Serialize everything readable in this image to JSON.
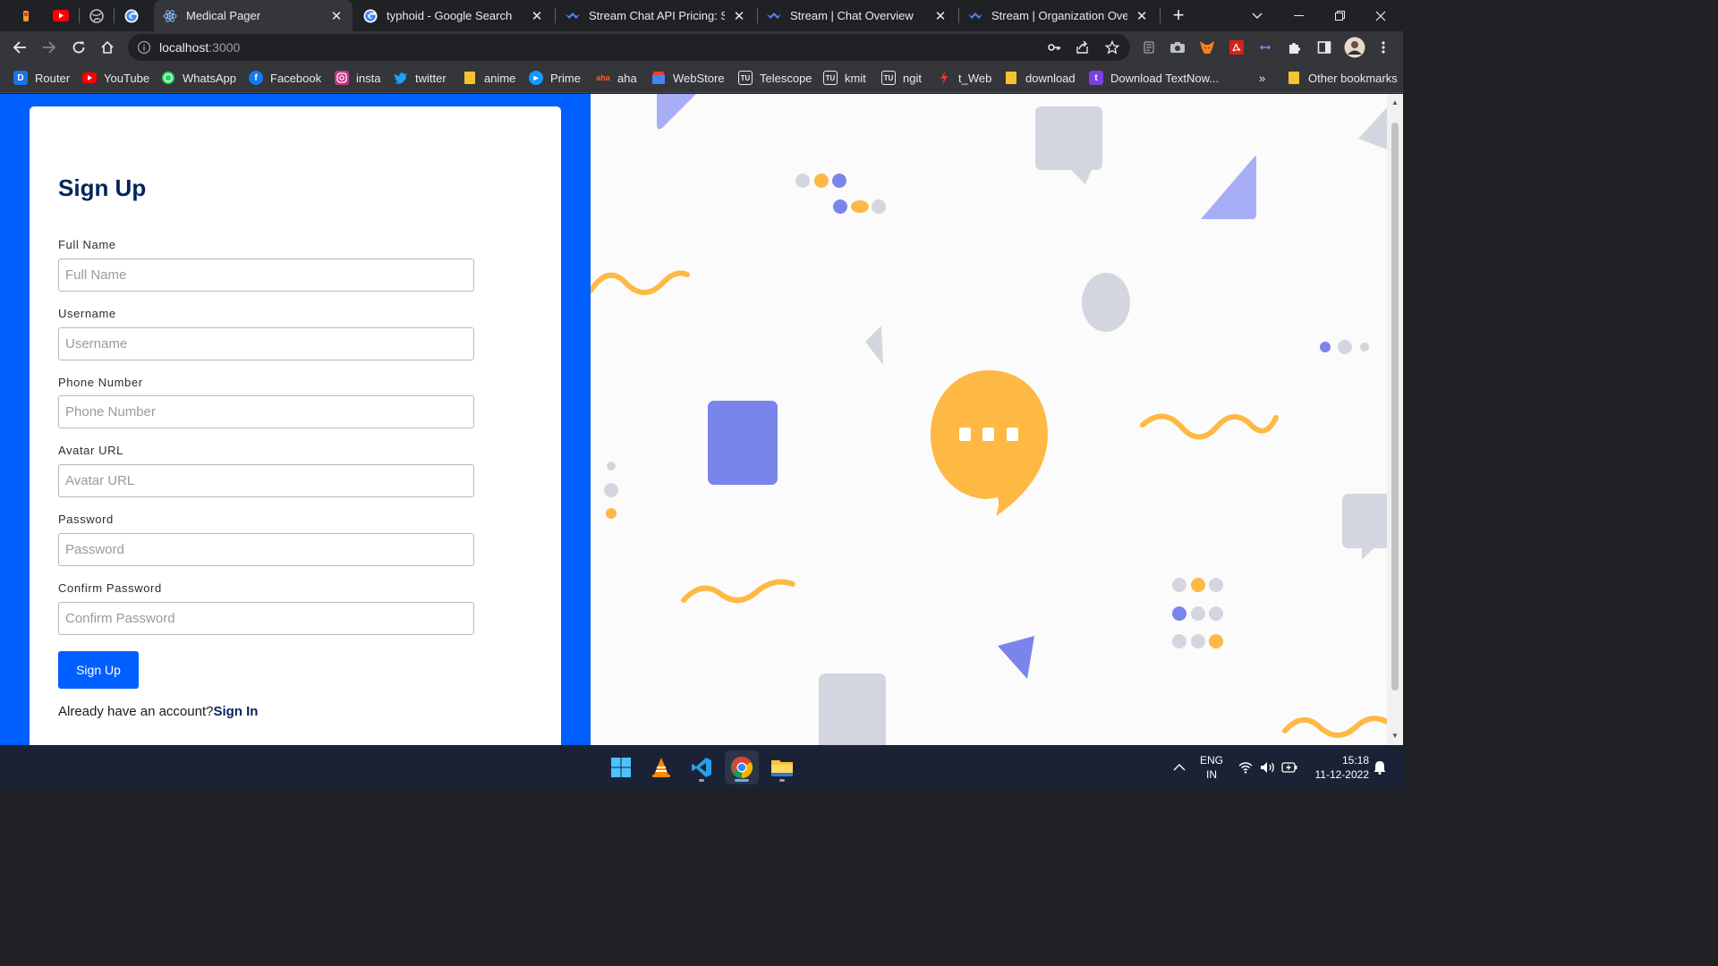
{
  "browser": {
    "tabs": [
      {
        "title": "Medical Pager",
        "icon": "react-icon",
        "active": true
      },
      {
        "title": "typhoid - Google Search",
        "icon": "google-icon",
        "active": false
      },
      {
        "title": "Stream Chat API Pricing: Start",
        "icon": "stream-icon",
        "active": false
      },
      {
        "title": "Stream | Chat Overview",
        "icon": "stream-icon",
        "active": false
      },
      {
        "title": "Stream | Organization Overvie",
        "icon": "stream-icon",
        "active": false
      }
    ],
    "url_host": "localhost",
    "url_port": ":3000",
    "bookmarks": [
      {
        "label": "Router",
        "icon": "d-icon",
        "color": "#1a73e8"
      },
      {
        "label": "YouTube",
        "icon": "youtube-icon",
        "color": "#ff0000"
      },
      {
        "label": "WhatsApp",
        "icon": "whatsapp-icon",
        "color": "#25d366"
      },
      {
        "label": "Facebook",
        "icon": "facebook-icon",
        "color": "#1877f2"
      },
      {
        "label": "insta",
        "icon": "instagram-icon",
        "color": "#c13584"
      },
      {
        "label": "twitter",
        "icon": "twitter-icon",
        "color": "#1da1f2"
      },
      {
        "label": "anime",
        "icon": "folder-icon",
        "color": "#f4c430"
      },
      {
        "label": "Prime",
        "icon": "prime-icon",
        "color": "#1399ff"
      },
      {
        "label": "aha",
        "icon": "aha-icon",
        "color": "#ff5a1f"
      },
      {
        "label": "WebStore",
        "icon": "webstore-icon",
        "color": "#4285f4"
      },
      {
        "label": "Telescope",
        "icon": "tu-icon",
        "color": "#e8eaed"
      },
      {
        "label": "kmit",
        "icon": "tu-icon",
        "color": "#e8eaed"
      },
      {
        "label": "ngit",
        "icon": "tu-icon",
        "color": "#e8eaed"
      },
      {
        "label": "t_Web",
        "icon": "lightning-icon",
        "color": "#e53935"
      },
      {
        "label": "download",
        "icon": "folder-icon",
        "color": "#f4c430"
      },
      {
        "label": "Download TextNow...",
        "icon": "textnow-icon",
        "color": "#7b3fe4"
      }
    ],
    "bookmarks_overflow": "»",
    "other_bookmarks": "Other bookmarks"
  },
  "signup": {
    "title": "Sign Up",
    "fields": [
      {
        "label": "Full Name",
        "placeholder": "Full Name"
      },
      {
        "label": "Username",
        "placeholder": "Username"
      },
      {
        "label": "Phone Number",
        "placeholder": "Phone Number"
      },
      {
        "label": "Avatar URL",
        "placeholder": "Avatar URL"
      },
      {
        "label": "Password",
        "placeholder": "Password"
      },
      {
        "label": "Confirm Password",
        "placeholder": "Confirm Password"
      }
    ],
    "submit_label": "Sign Up",
    "account_prompt": "Already have an account?",
    "signin_link": "Sign In"
  },
  "colors": {
    "primary_blue": "#005fff",
    "title_navy": "#05245a",
    "accent_yellow": "#fdb944",
    "accent_purple": "#7a85ec",
    "shape_gray": "#d3d6df"
  },
  "taskbar": {
    "apps": [
      "windows-start-icon",
      "vlc-icon",
      "vscode-icon",
      "chrome-icon",
      "file-explorer-icon"
    ],
    "language_line1": "ENG",
    "language_line2": "IN",
    "time": "15:18",
    "date": "11-12-2022"
  }
}
